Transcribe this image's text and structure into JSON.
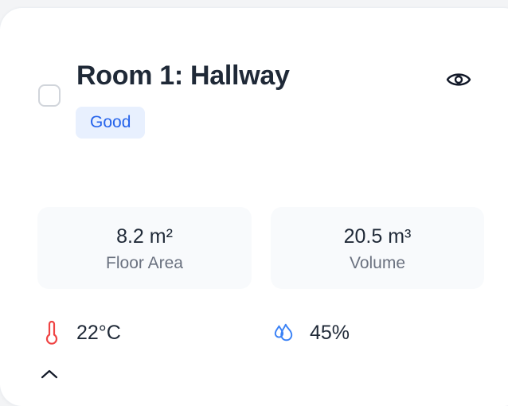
{
  "room": {
    "title": "Room 1: Hallway",
    "status": "Good"
  },
  "stats": {
    "floor_area": {
      "value": "8.2 m²",
      "label": "Floor Area"
    },
    "volume": {
      "value": "20.5 m³",
      "label": "Volume"
    }
  },
  "metrics": {
    "temperature": "22°C",
    "humidity": "45%"
  },
  "icons": {
    "visibility": "eye-icon",
    "temperature": "thermometer-icon",
    "humidity": "droplets-icon",
    "next_row": "home-icon"
  },
  "colors": {
    "badge_bg": "#e8f0fe",
    "badge_text": "#2563eb",
    "temperature_icon": "#ef4444",
    "humidity_icon": "#3b82f6"
  }
}
